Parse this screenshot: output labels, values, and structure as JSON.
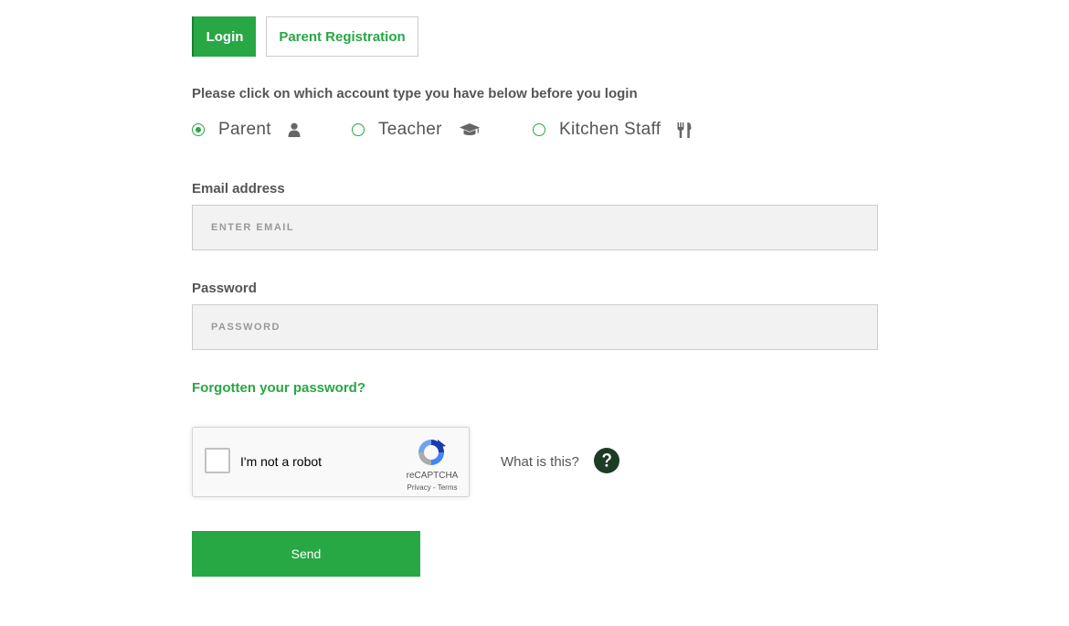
{
  "tabs": {
    "login": "Login",
    "register": "Parent Registration"
  },
  "instruction": "Please click on which account type you have below before you login",
  "account_types": [
    {
      "label": "Parent",
      "icon": "user-icon",
      "checked": true
    },
    {
      "label": "Teacher",
      "icon": "graduation-cap-icon",
      "checked": false
    },
    {
      "label": "Kitchen Staff",
      "icon": "cutlery-icon",
      "checked": false
    }
  ],
  "email": {
    "label": "Email address",
    "placeholder": "ENTER EMAIL",
    "value": ""
  },
  "password": {
    "label": "Password",
    "placeholder": "PASSWORD",
    "value": ""
  },
  "forgot_password": "Forgotten your password?",
  "recaptcha": {
    "label": "I'm not a robot",
    "brand": "reCAPTCHA",
    "privacy": "Privacy",
    "separator": " - ",
    "terms": "Terms"
  },
  "help": {
    "text": "What is this?",
    "icon": "question-circle-icon"
  },
  "send_label": "Send",
  "colors": {
    "accent": "#28a745",
    "text": "#555555",
    "field_bg": "#f2f2f2",
    "help_icon": "#1e3b26"
  }
}
